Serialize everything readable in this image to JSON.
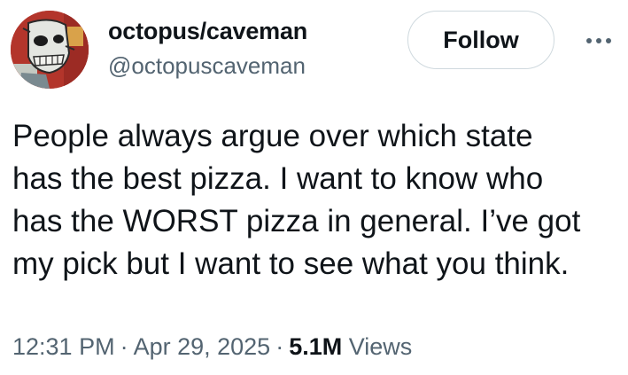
{
  "author": {
    "display_name": "octopus/caveman",
    "handle": "@octopuscaveman",
    "avatar_icon": "skull-portrait-avatar"
  },
  "actions": {
    "follow_label": "Follow",
    "more_icon": "more-horizontal-icon"
  },
  "tweet": {
    "lines": [
      "People always argue over which state",
      "has the best pizza. I want to know who",
      "has the WORST pizza in general. I’ve got",
      "my pick but I want to see what you think."
    ]
  },
  "meta": {
    "time": "12:31 PM",
    "separator": "·",
    "date": "Apr 29, 2025",
    "views_count": "5.1M",
    "views_label": "Views"
  },
  "colors": {
    "text_primary": "#0f1419",
    "text_secondary": "#536471",
    "button_border": "#cfd9de",
    "avatar_bg": "#b3352b"
  }
}
